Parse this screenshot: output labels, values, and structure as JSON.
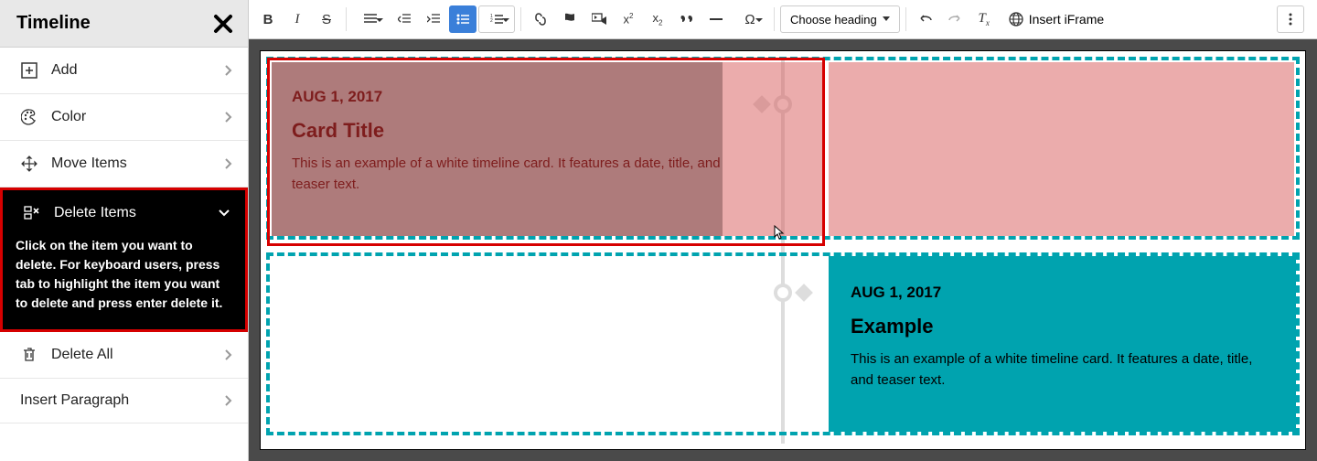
{
  "sidebar": {
    "title": "Timeline",
    "items": [
      {
        "label": "Add"
      },
      {
        "label": "Color"
      },
      {
        "label": "Move Items"
      },
      {
        "label": "Delete Items"
      },
      {
        "label": "Delete All"
      },
      {
        "label": "Insert Paragraph"
      }
    ],
    "delete_instructions": "Click on the item you want to delete. For keyboard users, press tab to highlight the item you want to delete and press enter delete it."
  },
  "toolbar": {
    "choose_heading": "Choose heading",
    "insert_iframe": "Insert iFrame"
  },
  "cards": [
    {
      "date": "AUG 1, 2017",
      "title": "Card Title",
      "teaser": "This is an example of a white timeline card. It features a date, title, and teaser text."
    },
    {
      "date": "AUG 1, 2017",
      "title": "Example",
      "teaser": "This is an example of a white timeline card. It features a date, title, and teaser text."
    }
  ]
}
